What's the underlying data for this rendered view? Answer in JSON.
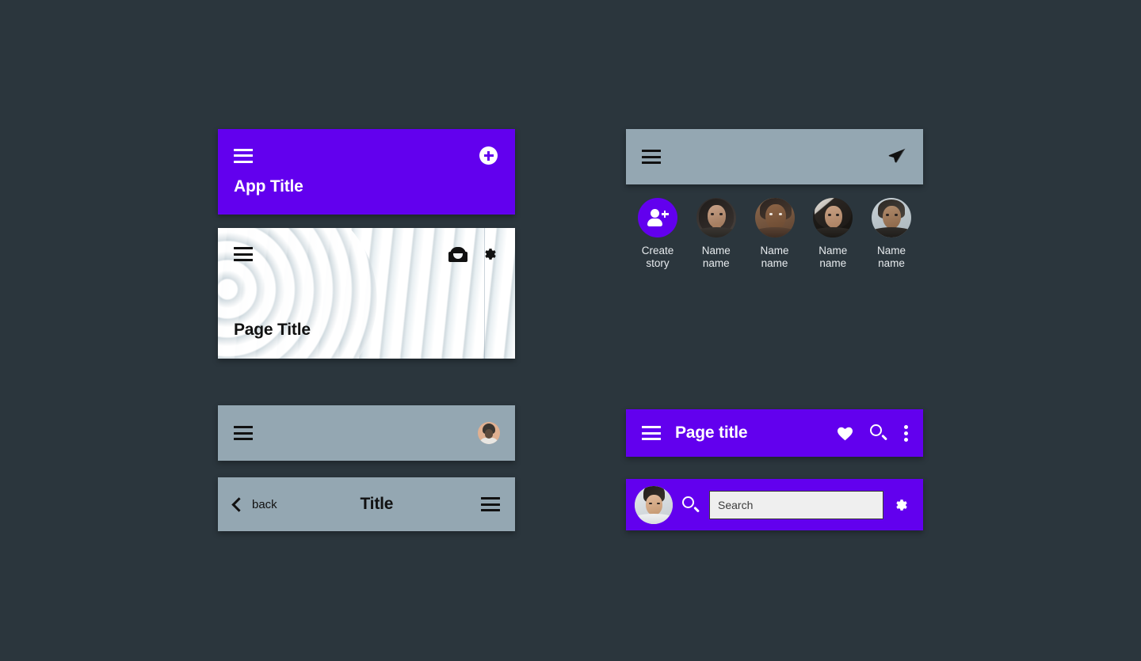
{
  "theme": {
    "page_background": "#2b363d",
    "purple": "#6200ee",
    "gray_bar": "#94a7b2",
    "white": "#ffffff",
    "black": "#111111",
    "input_background": "#efefef"
  },
  "app_title_bar": {
    "title": "App Title",
    "menu_icon": "hamburger-menu-icon",
    "action_icon": "add-circle-icon"
  },
  "page_title_card": {
    "title": "Page Title",
    "menu_icon": "hamburger-menu-icon",
    "inbox_icon": "inbox-icon",
    "settings_icon": "gear-icon"
  },
  "gray_avatar_bar": {
    "menu_icon": "hamburger-menu-icon",
    "avatar_icon": "user-avatar"
  },
  "back_title_bar": {
    "back_label": "back",
    "back_icon": "chevron-left-icon",
    "title": "Title",
    "menu_icon": "hamburger-menu-icon"
  },
  "send_bar": {
    "menu_icon": "hamburger-menu-icon",
    "send_icon": "paper-plane-icon"
  },
  "stories": {
    "items": [
      {
        "label": "Create\nstory",
        "type": "create",
        "icon": "person-add-icon"
      },
      {
        "label": "Name\nname",
        "type": "avatar"
      },
      {
        "label": "Name\nname",
        "type": "avatar"
      },
      {
        "label": "Name\nname",
        "type": "avatar"
      },
      {
        "label": "Name\nname",
        "type": "avatar"
      }
    ]
  },
  "purple_page_title_bar": {
    "title": "Page title",
    "menu_icon": "hamburger-menu-icon",
    "favorite_icon": "heart-icon",
    "search_icon": "search-icon",
    "overflow_icon": "more-vertical-icon"
  },
  "search_bar": {
    "avatar_icon": "user-avatar",
    "search_icon": "search-icon",
    "placeholder": "Search",
    "value": "",
    "settings_icon": "gear-icon"
  }
}
